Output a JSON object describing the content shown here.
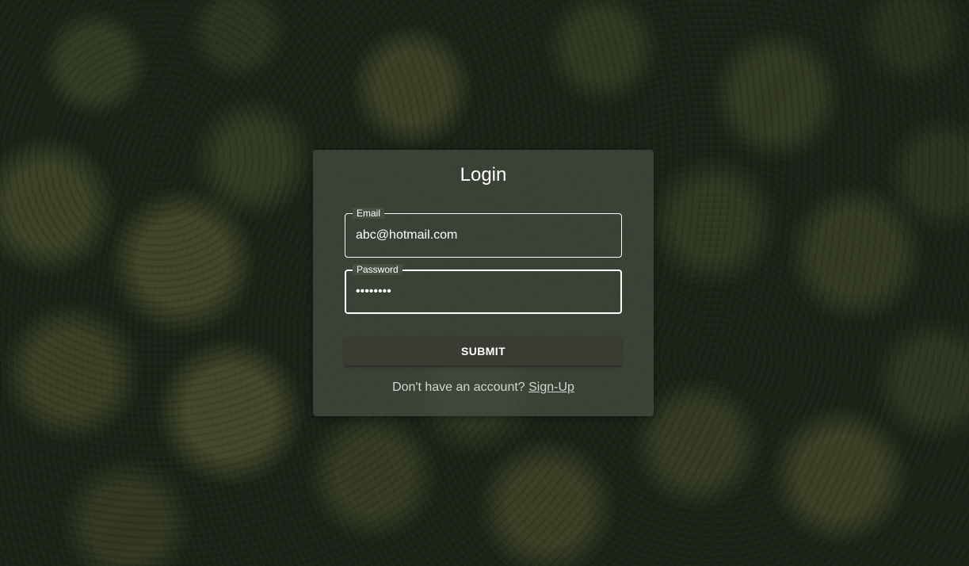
{
  "page": {
    "background": "forest-aerial-photo"
  },
  "login": {
    "title": "Login",
    "email": {
      "label": "Email",
      "value": "abc@hotmail.com"
    },
    "password": {
      "label": "Password",
      "value": "••••••••"
    },
    "submit_label": "SUBMIT",
    "signup_prompt": "Don't have an account?",
    "signup_link": "Sign-Up"
  },
  "colors": {
    "card_background": "#484e42",
    "text": "#ffffff",
    "muted_text": "#d3d5cf"
  }
}
